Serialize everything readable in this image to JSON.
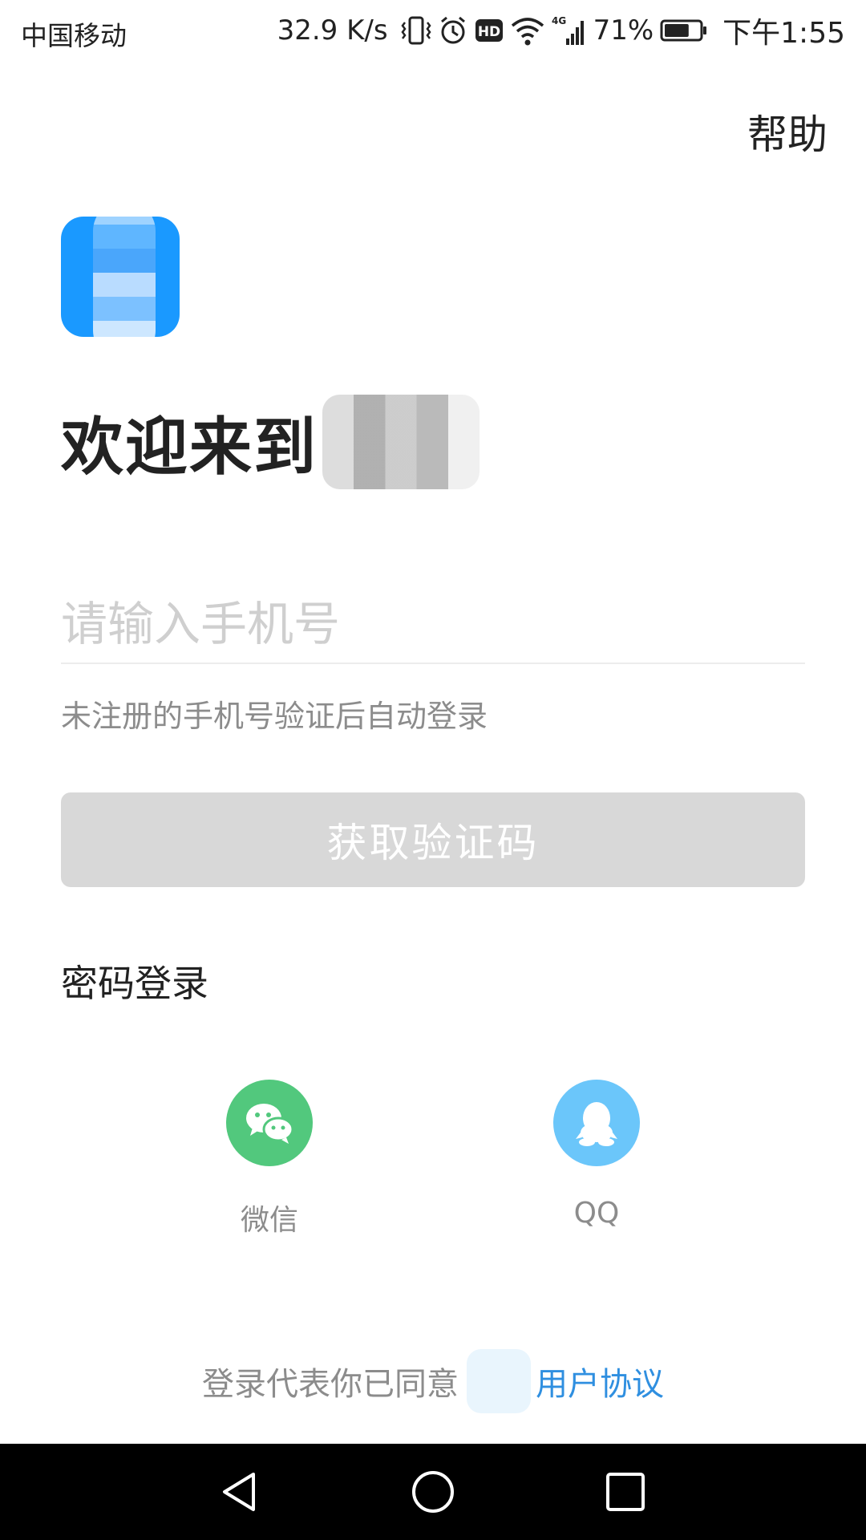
{
  "status_bar": {
    "carrier": "中国移动",
    "network_speed": "32.9 K/s",
    "hd_badge": "HD",
    "network_type": "4G",
    "battery_percent": "71%",
    "battery_level": 0.71,
    "time": "下午1:55",
    "icons": [
      "vibrate-icon",
      "alarm-icon",
      "hd-icon",
      "wifi-icon",
      "signal-icon",
      "battery-icon"
    ]
  },
  "header": {
    "help_label": "帮助"
  },
  "welcome": {
    "title": "欢迎来到"
  },
  "phone_input": {
    "value": "",
    "placeholder": "请输入手机号"
  },
  "hint": "未注册的手机号验证后自动登录",
  "get_code_label": "获取验证码",
  "password_login_label": "密码登录",
  "third_party": [
    {
      "label": "微信",
      "icon": "wechat-icon",
      "color": "#52c87d"
    },
    {
      "label": "QQ",
      "icon": "qq-icon",
      "color": "#6bc6fa"
    }
  ],
  "agreement": {
    "prefix": "登录代表你已同意",
    "link_label": "用户协议",
    "link_color": "#2f8fe0"
  },
  "colors": {
    "logo": "#1a99ff",
    "button_disabled": "#d8d8d8",
    "text_primary": "#222222",
    "text_secondary": "#8c8c8c"
  }
}
